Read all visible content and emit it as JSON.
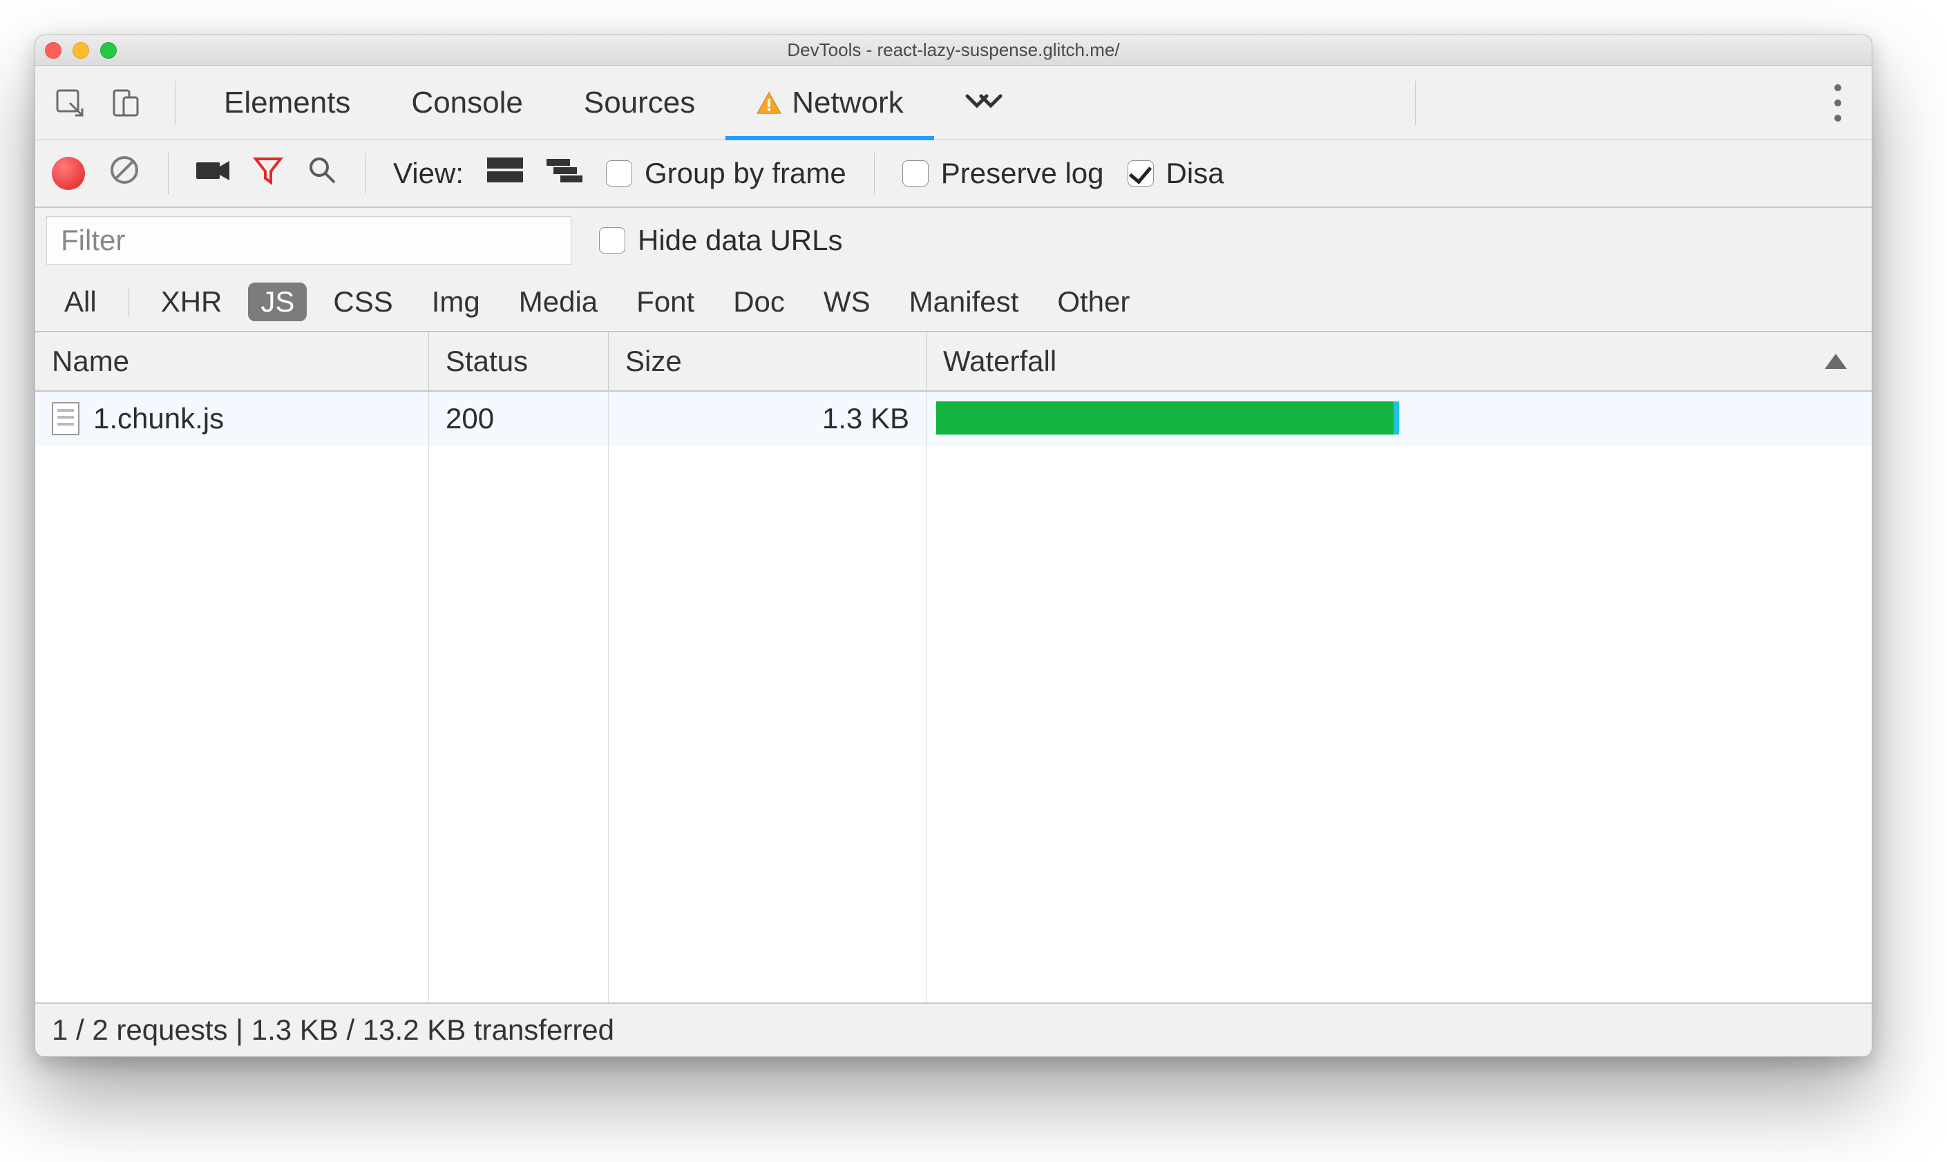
{
  "title": "DevTools - react-lazy-suspense.glitch.me/",
  "tabs": {
    "elements": "Elements",
    "console": "Console",
    "sources": "Sources",
    "network": "Network"
  },
  "toolbar": {
    "view_label": "View:",
    "group_by_frame": "Group by frame",
    "preserve_log": "Preserve log",
    "disable_cache": "Disa"
  },
  "filter": {
    "placeholder": "Filter",
    "hide_data_urls": "Hide data URLs"
  },
  "types": [
    "All",
    "XHR",
    "JS",
    "CSS",
    "Img",
    "Media",
    "Font",
    "Doc",
    "WS",
    "Manifest",
    "Other"
  ],
  "types_active": "JS",
  "columns": {
    "name": "Name",
    "status": "Status",
    "size": "Size",
    "waterfall": "Waterfall"
  },
  "rows": [
    {
      "name": "1.chunk.js",
      "status": "200",
      "size": "1.3 KB",
      "wf_left_pct": 1,
      "wf_width_pct": 49
    }
  ],
  "status": "1 / 2 requests | 1.3 KB / 13.2 KB transferred"
}
